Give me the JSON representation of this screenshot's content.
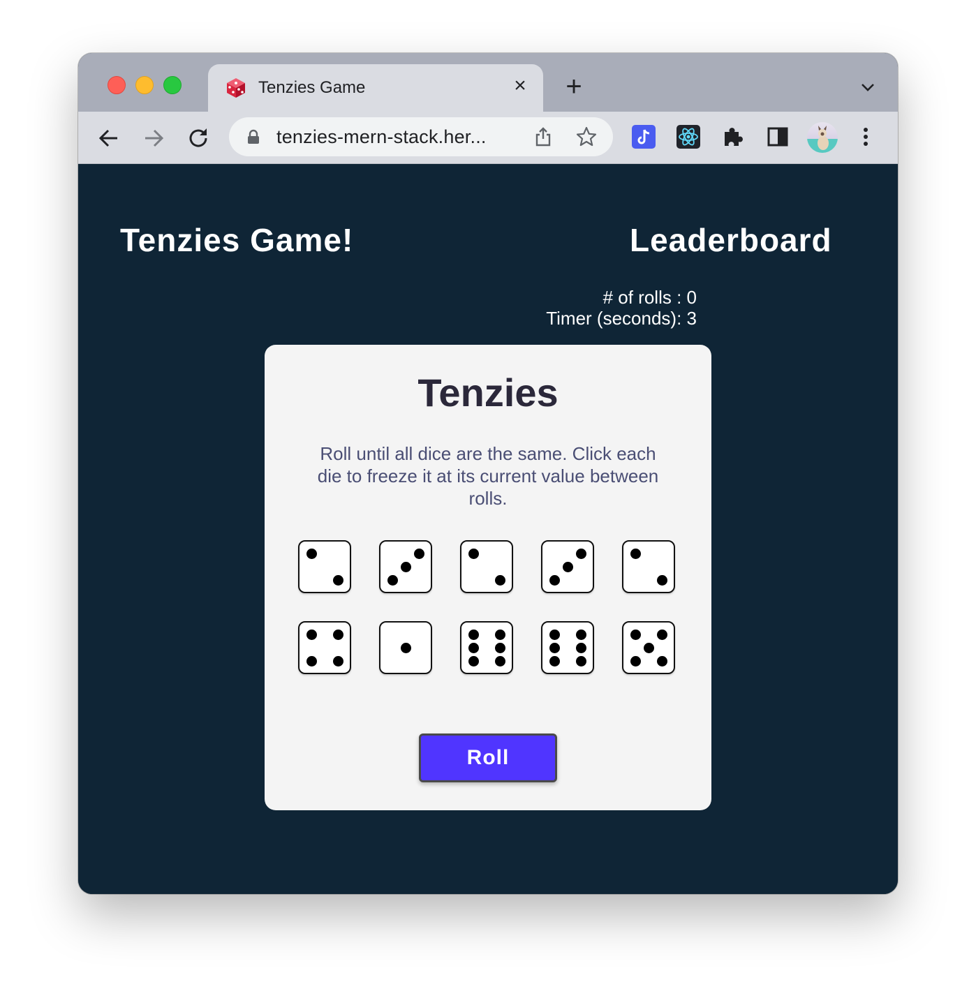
{
  "browser": {
    "tab_title": "Tenzies Game",
    "url": "tenzies-mern-stack.her...",
    "icons": [
      "back-arrow-icon",
      "forward-arrow-icon",
      "reload-icon",
      "lock-icon",
      "share-icon",
      "star-icon",
      "extension-icons",
      "puzzle-icon",
      "side-panel-icon",
      "profile-avatar",
      "more-icon"
    ]
  },
  "page": {
    "app_title": "Tenzies Game!",
    "leaderboard_label": "Leaderboard",
    "rolls_text": "# of rolls : 0",
    "timer_text": "Timer (seconds): 3"
  },
  "game": {
    "title": "Tenzies",
    "instructions": "Roll until all dice are the same. Click each die to freeze it at its current value between rolls.",
    "dice": [
      2,
      3,
      2,
      3,
      2,
      4,
      1,
      6,
      6,
      5
    ],
    "roll_label": "Roll"
  },
  "colors": {
    "background": "#0f2536",
    "card": "#f4f4f4",
    "title": "#2b283a",
    "instructions": "#4a4e74",
    "button": "#5035ff"
  }
}
